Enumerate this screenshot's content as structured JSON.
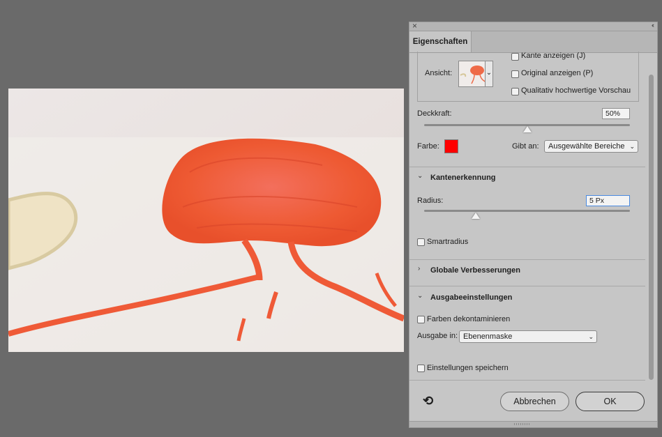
{
  "canvas": {
    "image_alt": "painting-red-mushroom-cloud"
  },
  "panel": {
    "tab_label": "Eigenschaften",
    "close_icon": "close-icon",
    "collapse_icon": "collapse-icon",
    "view": {
      "label": "Ansicht:",
      "options": [
        {
          "label": "Kante anzeigen (J)",
          "checked": false
        },
        {
          "label": "Original anzeigen (P)",
          "checked": false
        },
        {
          "label": "Qualitativ hochwertige Vorschau",
          "checked": false
        }
      ]
    },
    "opacity": {
      "label": "Deckkraft:",
      "value": "50%",
      "fraction": 0.5
    },
    "color": {
      "label": "Farbe:",
      "swatch": "#ff0000"
    },
    "show_on": {
      "label": "Gibt an:",
      "value": "Ausgewählte Bereiche"
    },
    "edge_detection": {
      "title": "Kantenerkennung",
      "expanded": true,
      "radius_label": "Radius:",
      "radius_value": "5 Px",
      "radius_fraction": 0.25,
      "smart_radius_label": "Smartradius",
      "smart_radius_checked": false
    },
    "global_refinements": {
      "title": "Globale Verbesserungen",
      "expanded": false
    },
    "output": {
      "title": "Ausgabeeinstellungen",
      "expanded": true,
      "decontaminate_label": "Farben dekontaminieren",
      "decontaminate_checked": false,
      "output_to_label": "Ausgabe in:",
      "output_to_value": "Ebenenmaske"
    },
    "remember_label": "Einstellungen speichern",
    "remember_checked": false,
    "reset_icon": "reset-icon",
    "cancel_label": "Abbrechen",
    "ok_label": "OK"
  }
}
